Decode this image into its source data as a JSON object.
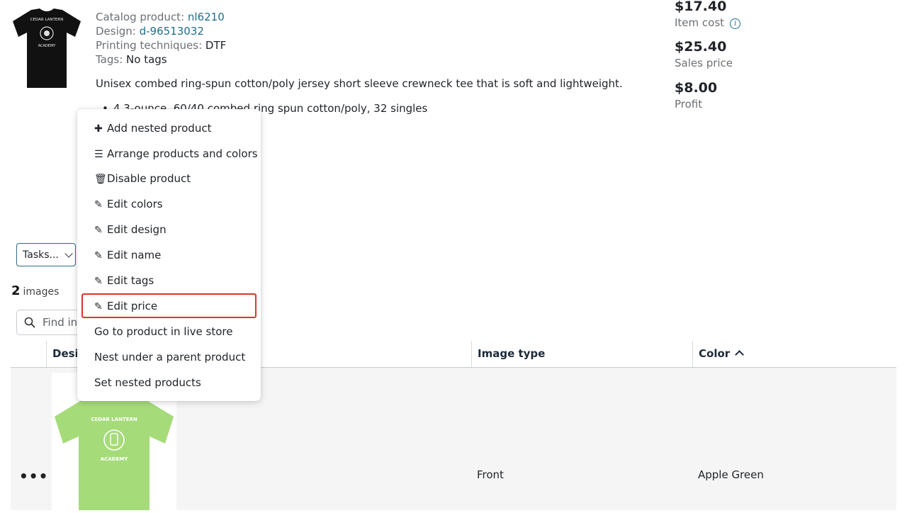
{
  "product": {
    "catalog_label": "Catalog product:",
    "catalog_value": "nl6210",
    "design_label": "Design:",
    "design_value": "d-96513032",
    "printing_label": "Printing techniques:",
    "printing_value": "DTF",
    "tags_label": "Tags:",
    "tags_value": "No tags",
    "description": "Unisex combed ring-spun cotton/poly jersey short sleeve crewneck tee that is soft and lightweight.",
    "bullet_1": "4.3-ounce, 60/40 combed ring spun cotton/poly, 32 singles",
    "shirt_text_top": "CEDAR LANTERN",
    "shirt_text_bottom": "ACADEMY",
    "thumbnail_color": "#111111"
  },
  "pricing": {
    "item_cost_value": "$17.40",
    "item_cost_label": "Item cost",
    "sales_price_value": "$25.40",
    "sales_price_label": "Sales price",
    "profit_value": "$8.00",
    "profit_label": "Profit"
  },
  "tasks": {
    "label": "Tasks..."
  },
  "images": {
    "count": "2",
    "label": "images"
  },
  "search": {
    "placeholder": "Find in"
  },
  "table": {
    "columns": [
      "Desig",
      "Image type",
      "Color"
    ],
    "rows": [
      {
        "image_type": "Front",
        "color": "Apple Green",
        "shirt_color": "#a6db7a"
      }
    ],
    "row_menu": "•••"
  },
  "menu": {
    "items": [
      {
        "icon": "plus-icon",
        "label": "Add nested product"
      },
      {
        "icon": "bars-icon",
        "label": "Arrange products and colors"
      },
      {
        "icon": "trash-icon",
        "label": "Disable product"
      },
      {
        "icon": "pencil-icon",
        "label": "Edit colors"
      },
      {
        "icon": "pencil-icon",
        "label": "Edit design"
      },
      {
        "icon": "pencil-icon",
        "label": "Edit name"
      },
      {
        "icon": "pencil-icon",
        "label": "Edit tags"
      },
      {
        "icon": "pencil-icon",
        "label": "Edit price"
      },
      {
        "icon": "",
        "label": "Go to product in live store"
      },
      {
        "icon": "",
        "label": "Nest under a parent product"
      },
      {
        "icon": "",
        "label": "Set nested products"
      }
    ],
    "highlighted": "Edit price",
    "highlight_color": "#d9352e"
  }
}
